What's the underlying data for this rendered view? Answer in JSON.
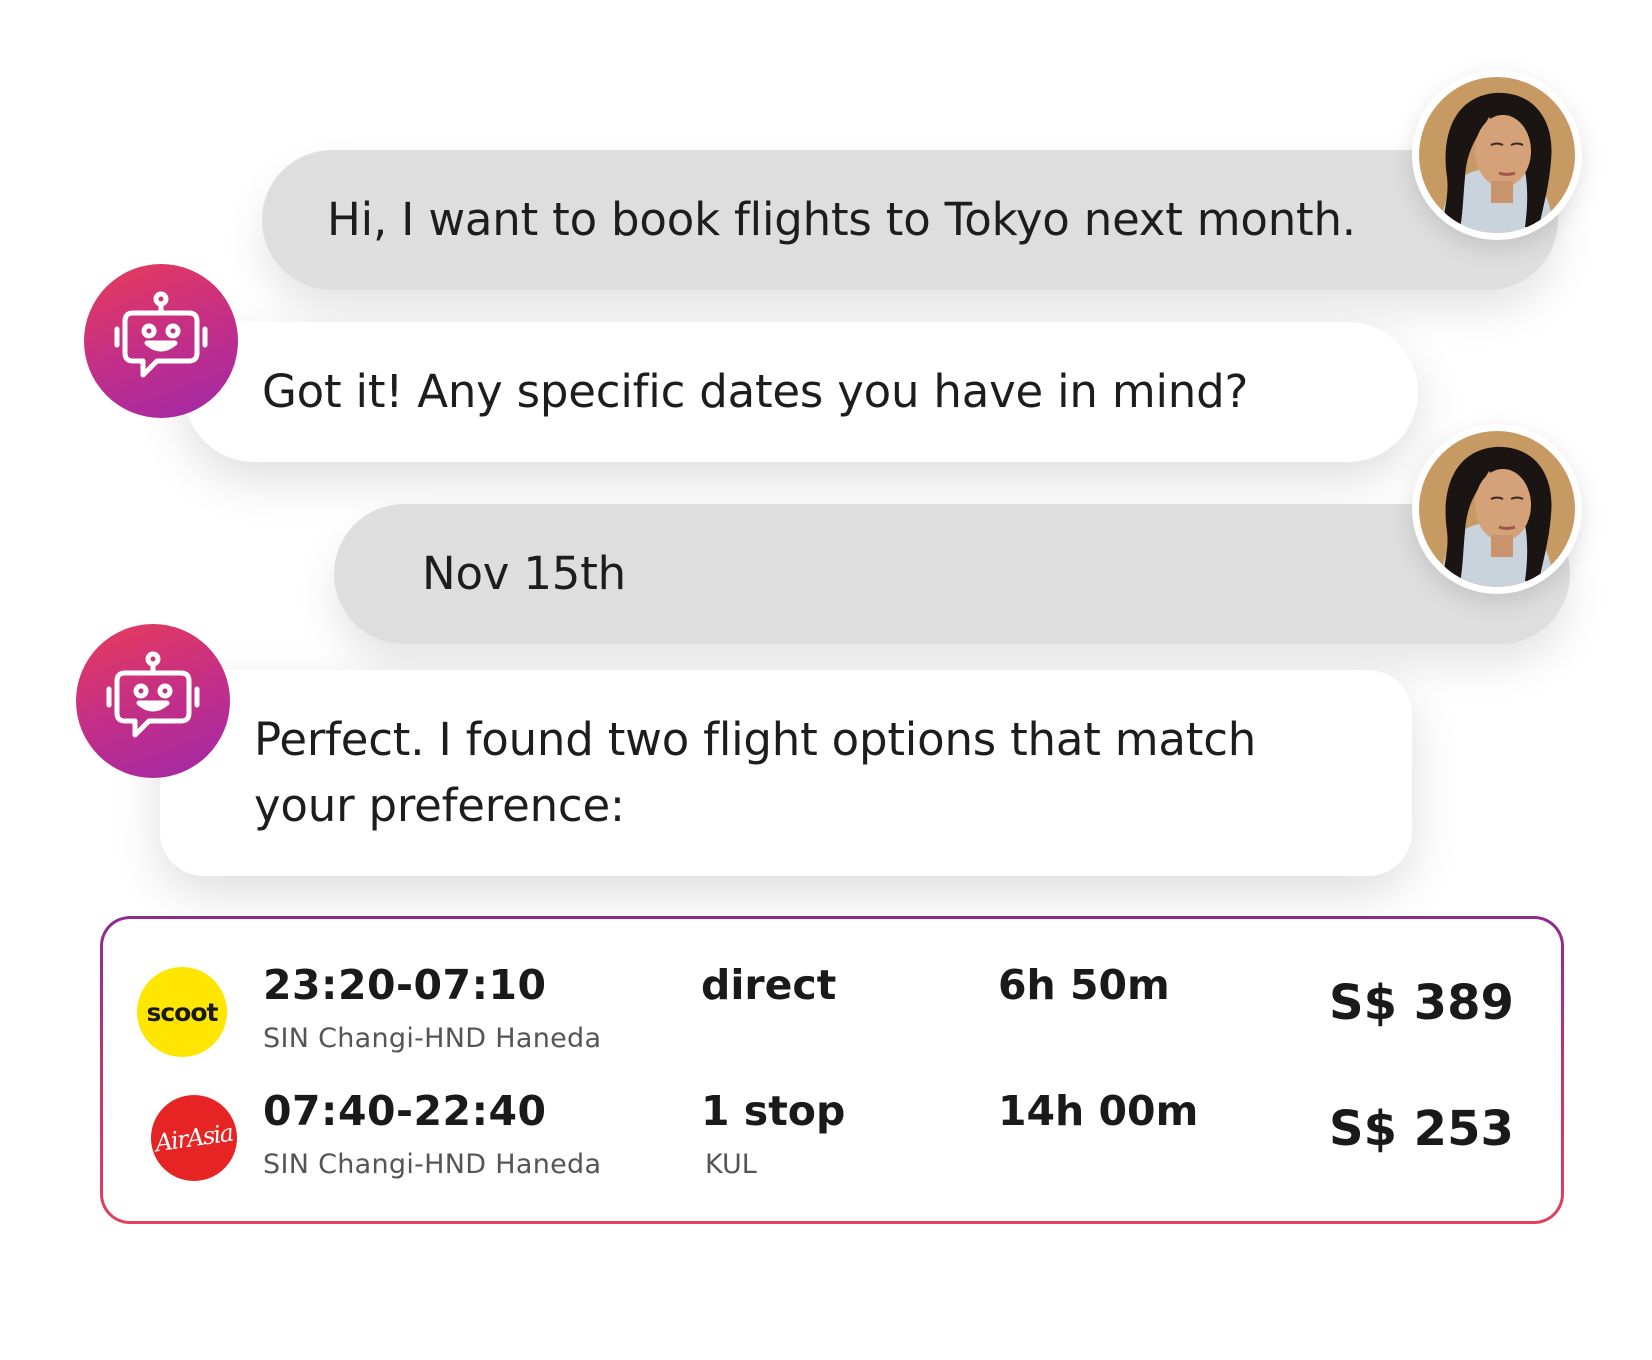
{
  "conversation": {
    "user_message_1": "Hi, I want to book flights to Tokyo next month.",
    "bot_message_1": "Got it! Any specific dates you have in mind?",
    "user_message_2": "Nov 15th",
    "bot_message_2_line1": "Perfect. I found two flight options that match",
    "bot_message_2_line2": "your preference:"
  },
  "avatars": {
    "user_icon": "user-portrait-icon",
    "bot_icon": "robot-icon"
  },
  "flights": [
    {
      "airline_logo_text": "scoot",
      "airline_logo_icon": "scoot-logo-icon",
      "times": "23:20-07:10",
      "route": "SIN Changi-HND Haneda",
      "stops": "direct",
      "via": "",
      "duration": "6h 50m",
      "price": "S$ 389"
    },
    {
      "airline_logo_text": "AirAsia",
      "airline_logo_icon": "airasia-logo-icon",
      "times": "07:40-22:40",
      "route": "SIN Changi-HND Haneda",
      "stops": "1 stop",
      "via": "KUL",
      "duration": "14h 00m",
      "price": "S$ 253"
    }
  ],
  "colors": {
    "user_bubble": "#dedede",
    "bot_bubble": "#ffffff",
    "bot_avatar_gradient_start": "#e83b5a",
    "bot_avatar_gradient_end": "#a028a8",
    "card_border_start": "#8e2b8f",
    "card_border_end": "#e0415d",
    "scoot_yellow": "#ffe600",
    "airasia_red": "#e62424"
  }
}
